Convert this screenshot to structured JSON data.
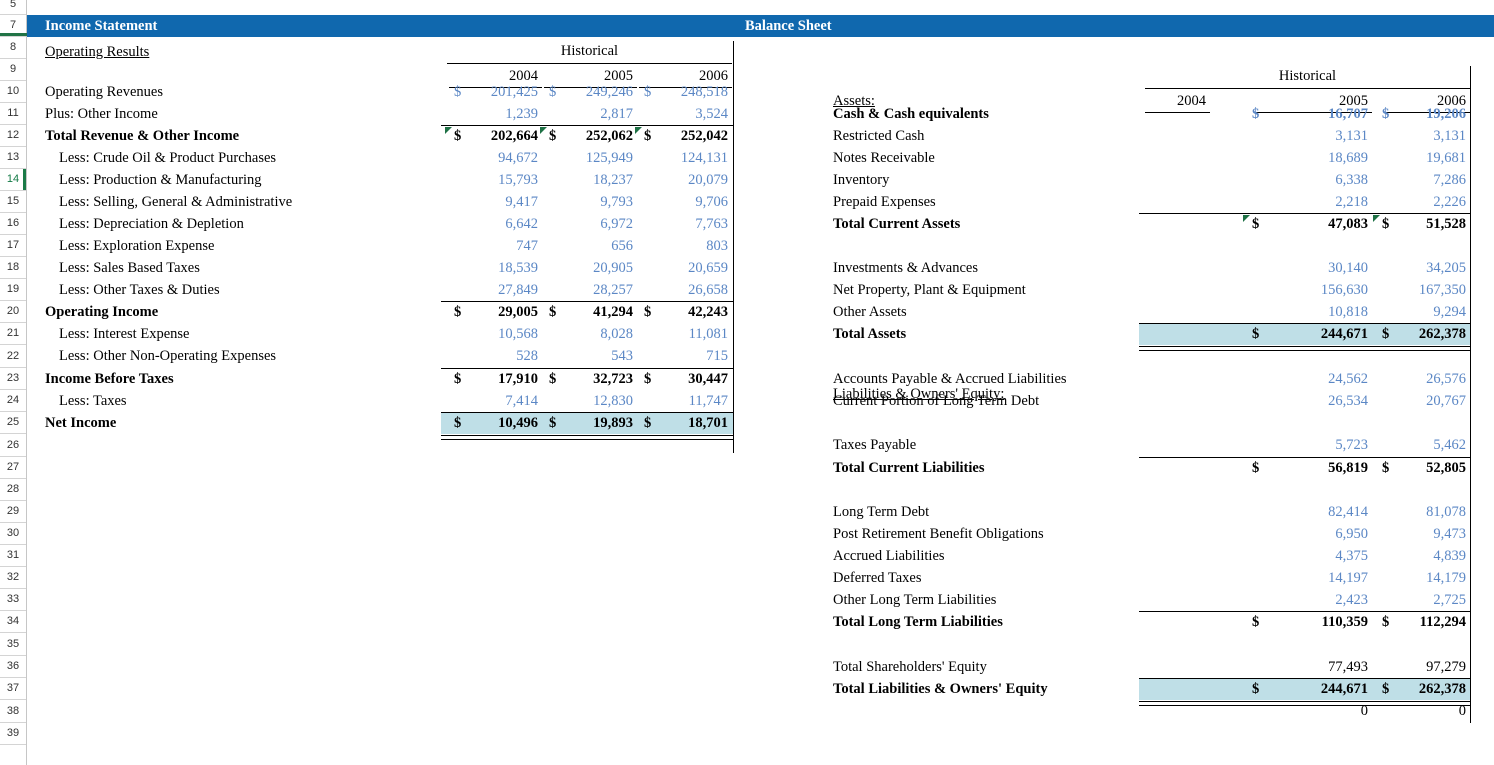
{
  "workbook": {
    "title_left": "Income Statement",
    "title_right": "Balance Sheet",
    "accent_header": "#1068ae",
    "total_fill": "#bfdfe7",
    "input_color": "#5b87c5",
    "active_row": "14"
  },
  "row_headers": [
    "5",
    "7",
    "8",
    "9",
    "10",
    "11",
    "12",
    "13",
    "14",
    "15",
    "16",
    "17",
    "18",
    "19",
    "20",
    "21",
    "22",
    "23",
    "24",
    "25",
    "26",
    "27",
    "28",
    "29",
    "30",
    "31",
    "32",
    "33",
    "34",
    "35",
    "36",
    "37",
    "38",
    "39"
  ],
  "income_statement": {
    "section_label": "Operating Results",
    "period_label": "Historical",
    "years": [
      "2004",
      "2005",
      "2006"
    ],
    "rows": [
      {
        "label": "Operating Revenues",
        "bold": false,
        "indent": 0,
        "style": "input",
        "cur": [
          "$",
          "$",
          "$"
        ],
        "values": [
          "201,425",
          "249,246",
          "248,518"
        ]
      },
      {
        "label": "Plus:  Other Income",
        "bold": false,
        "indent": 0,
        "style": "input",
        "cur": [
          "",
          "",
          ""
        ],
        "values": [
          "1,239",
          "2,817",
          "3,524"
        ]
      },
      {
        "label": "Total Revenue & Other Income",
        "bold": true,
        "indent": 0,
        "style": "total",
        "cur": [
          "$",
          "$",
          "$"
        ],
        "values": [
          "202,664",
          "252,062",
          "252,042"
        ],
        "comment": true
      },
      {
        "label": "Less:  Crude Oil & Product Purchases",
        "bold": false,
        "indent": 1,
        "style": "input",
        "cur": [
          "",
          "",
          ""
        ],
        "values": [
          "94,672",
          "125,949",
          "124,131"
        ]
      },
      {
        "label": "Less:  Production & Manufacturing",
        "bold": false,
        "indent": 1,
        "style": "input",
        "cur": [
          "",
          "",
          ""
        ],
        "values": [
          "15,793",
          "18,237",
          "20,079"
        ]
      },
      {
        "label": "Less:  Selling, General & Administrative",
        "bold": false,
        "indent": 1,
        "style": "input",
        "cur": [
          "",
          "",
          ""
        ],
        "values": [
          "9,417",
          "9,793",
          "9,706"
        ]
      },
      {
        "label": "Less:  Depreciation & Depletion",
        "bold": false,
        "indent": 1,
        "style": "input",
        "cur": [
          "",
          "",
          ""
        ],
        "values": [
          "6,642",
          "6,972",
          "7,763"
        ]
      },
      {
        "label": "Less:  Exploration Expense",
        "bold": false,
        "indent": 1,
        "style": "input",
        "cur": [
          "",
          "",
          ""
        ],
        "values": [
          "747",
          "656",
          "803"
        ]
      },
      {
        "label": "Less:  Sales Based Taxes",
        "bold": false,
        "indent": 1,
        "style": "input",
        "cur": [
          "",
          "",
          ""
        ],
        "values": [
          "18,539",
          "20,905",
          "20,659"
        ]
      },
      {
        "label": "Less:  Other Taxes & Duties",
        "bold": false,
        "indent": 1,
        "style": "input",
        "cur": [
          "",
          "",
          ""
        ],
        "values": [
          "27,849",
          "28,257",
          "26,658"
        ]
      },
      {
        "label": "Operating Income",
        "bold": true,
        "indent": 0,
        "style": "total",
        "cur": [
          "$",
          "$",
          "$"
        ],
        "values": [
          "29,005",
          "41,294",
          "42,243"
        ]
      },
      {
        "label": "Less:  Interest Expense",
        "bold": false,
        "indent": 1,
        "style": "input",
        "cur": [
          "",
          "",
          ""
        ],
        "values": [
          "10,568",
          "8,028",
          "11,081"
        ]
      },
      {
        "label": "Less:  Other Non-Operating Expenses",
        "bold": false,
        "indent": 1,
        "style": "input",
        "cur": [
          "",
          "",
          ""
        ],
        "values": [
          "528",
          "543",
          "715"
        ]
      },
      {
        "label": "Income Before Taxes",
        "bold": true,
        "indent": 0,
        "style": "total",
        "cur": [
          "$",
          "$",
          "$"
        ],
        "values": [
          "17,910",
          "32,723",
          "30,447"
        ]
      },
      {
        "label": "Less:  Taxes",
        "bold": false,
        "indent": 1,
        "style": "input",
        "cur": [
          "",
          "",
          ""
        ],
        "values": [
          "7,414",
          "12,830",
          "11,747"
        ]
      },
      {
        "label": "Net Income",
        "bold": true,
        "indent": 0,
        "style": "grand",
        "cur": [
          "$",
          "$",
          "$"
        ],
        "values": [
          "10,496",
          "19,893",
          "18,701"
        ]
      }
    ]
  },
  "balance_sheet": {
    "period_label": "Historical",
    "years": [
      "2004",
      "2005",
      "2006"
    ],
    "assets_header": "Assets:",
    "liabilities_header": "Liabilities & Owners' Equity:",
    "rows": [
      {
        "label": "Cash & Cash equivalents",
        "bold": true,
        "style": "input-bold",
        "cur": [
          "",
          "$",
          "$"
        ],
        "values": [
          "",
          "16,707",
          "19,206"
        ]
      },
      {
        "label": "Restricted Cash",
        "bold": false,
        "style": "input",
        "cur": [
          "",
          "",
          ""
        ],
        "values": [
          "",
          "3,131",
          "3,131"
        ]
      },
      {
        "label": "Notes Receivable",
        "bold": false,
        "style": "input",
        "cur": [
          "",
          "",
          ""
        ],
        "values": [
          "",
          "18,689",
          "19,681"
        ]
      },
      {
        "label": "Inventory",
        "bold": false,
        "style": "input",
        "cur": [
          "",
          "",
          ""
        ],
        "values": [
          "",
          "6,338",
          "7,286"
        ]
      },
      {
        "label": "Prepaid Expenses",
        "bold": false,
        "style": "input",
        "cur": [
          "",
          "",
          ""
        ],
        "values": [
          "",
          "2,218",
          "2,226"
        ]
      },
      {
        "label": "Total Current Assets",
        "bold": true,
        "style": "total",
        "cur": [
          "",
          "$",
          "$"
        ],
        "values": [
          "",
          "47,083",
          "51,528"
        ],
        "comment": true
      },
      {
        "label": "Investments & Advances",
        "bold": false,
        "style": "input",
        "cur": [
          "",
          "",
          ""
        ],
        "values": [
          "",
          "30,140",
          "34,205"
        ]
      },
      {
        "label": "Net Property, Plant & Equipment",
        "bold": false,
        "style": "input",
        "cur": [
          "",
          "",
          ""
        ],
        "values": [
          "",
          "156,630",
          "167,350"
        ]
      },
      {
        "label": "Other Assets",
        "bold": false,
        "style": "input",
        "cur": [
          "",
          "",
          ""
        ],
        "values": [
          "",
          "10,818",
          "9,294"
        ]
      },
      {
        "label": "Total Assets",
        "bold": true,
        "style": "grand",
        "cur": [
          "",
          "$",
          "$"
        ],
        "values": [
          "",
          "244,671",
          "262,378"
        ]
      },
      {
        "label": "Accounts Payable & Accrued Liabilities",
        "bold": false,
        "style": "input",
        "cur": [
          "",
          "",
          ""
        ],
        "values": [
          "",
          "24,562",
          "26,576"
        ]
      },
      {
        "label": "Current Portion of Long Term Debt",
        "bold": false,
        "style": "input",
        "cur": [
          "",
          "",
          ""
        ],
        "values": [
          "",
          "26,534",
          "20,767"
        ]
      },
      {
        "label": "Taxes Payable",
        "bold": false,
        "style": "input",
        "cur": [
          "",
          "",
          ""
        ],
        "values": [
          "",
          "5,723",
          "5,462"
        ]
      },
      {
        "label": "Total Current Liabilities",
        "bold": true,
        "style": "total",
        "cur": [
          "",
          "$",
          "$"
        ],
        "values": [
          "",
          "56,819",
          "52,805"
        ]
      },
      {
        "label": "Long Term Debt",
        "bold": false,
        "style": "input",
        "cur": [
          "",
          "",
          ""
        ],
        "values": [
          "",
          "82,414",
          "81,078"
        ]
      },
      {
        "label": "Post Retirement Benefit Obligations",
        "bold": false,
        "style": "input",
        "cur": [
          "",
          "",
          ""
        ],
        "values": [
          "",
          "6,950",
          "9,473"
        ]
      },
      {
        "label": "Accrued Liabilities",
        "bold": false,
        "style": "input",
        "cur": [
          "",
          "",
          ""
        ],
        "values": [
          "",
          "4,375",
          "4,839"
        ]
      },
      {
        "label": "Deferred Taxes",
        "bold": false,
        "style": "input",
        "cur": [
          "",
          "",
          ""
        ],
        "values": [
          "",
          "14,197",
          "14,179"
        ]
      },
      {
        "label": "Other Long Term Liabilities",
        "bold": false,
        "style": "input",
        "cur": [
          "",
          "",
          ""
        ],
        "values": [
          "",
          "2,423",
          "2,725"
        ]
      },
      {
        "label": "Total Long Term Liabilities",
        "bold": true,
        "style": "total",
        "cur": [
          "",
          "$",
          "$"
        ],
        "values": [
          "",
          "110,359",
          "112,294"
        ]
      },
      {
        "label": "Total Shareholders' Equity",
        "bold": false,
        "style": "calc",
        "cur": [
          "",
          "",
          ""
        ],
        "values": [
          "",
          "77,493",
          "97,279"
        ]
      },
      {
        "label": "Total Liabilities & Owners' Equity",
        "bold": true,
        "style": "grand",
        "cur": [
          "",
          "$",
          "$"
        ],
        "values": [
          "",
          "244,671",
          "262,378"
        ]
      },
      {
        "label": "",
        "bold": false,
        "style": "check",
        "cur": [
          "",
          "",
          ""
        ],
        "values": [
          "",
          "0",
          "0"
        ]
      }
    ]
  }
}
